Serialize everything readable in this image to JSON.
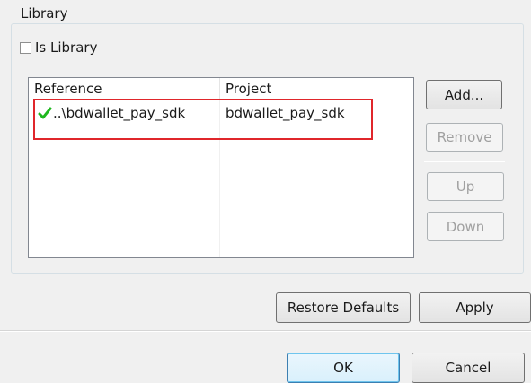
{
  "library": {
    "group_title": "Library",
    "is_library_label": "Is Library",
    "is_library_checked": false
  },
  "references_table": {
    "headers": [
      "Reference",
      "Project"
    ],
    "rows": [
      {
        "reference": "..\\bdwallet_pay_sdk",
        "project": "bdwallet_pay_sdk",
        "status_icon": "check-icon"
      }
    ]
  },
  "side_buttons": {
    "add": "Add...",
    "remove": "Remove",
    "up": "Up",
    "down": "Down"
  },
  "page_buttons": {
    "restore_defaults": "Restore Defaults",
    "apply": "Apply"
  },
  "dialog_buttons": {
    "ok": "OK",
    "cancel": "Cancel"
  },
  "colors": {
    "highlight": "#e0262b",
    "check": "#1fb81f"
  }
}
